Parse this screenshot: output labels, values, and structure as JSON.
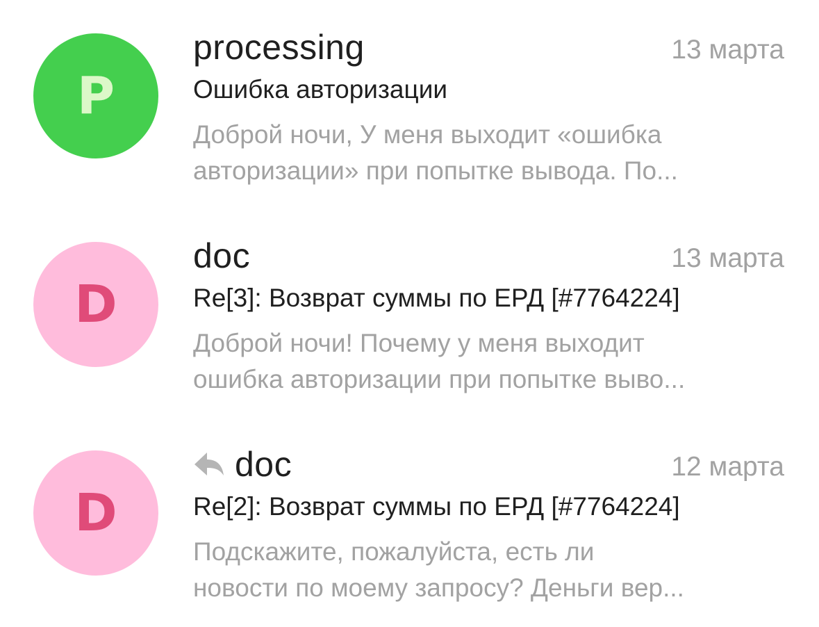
{
  "messages": [
    {
      "avatar_letter": "P",
      "avatar_bg": "#44cf4e",
      "avatar_fg": "#dcf8c8",
      "replied": false,
      "sender": "processing",
      "date": "13 марта",
      "subject": "Ошибка авторизации",
      "preview_line1": "Доброй ночи, У меня выходит «ошибка",
      "preview_line2": "авторизации» при попытке вывода. По..."
    },
    {
      "avatar_letter": "D",
      "avatar_bg": "#ffbcdc",
      "avatar_fg": "#e04b79",
      "replied": false,
      "sender": "doc",
      "date": "13 марта",
      "subject": "Re[3]: Возврат суммы по ЕРД [#7764224]",
      "preview_line1": "Доброй ночи! Почему у меня выходит",
      "preview_line2": "ошибка авторизации при попытке выво..."
    },
    {
      "avatar_letter": "D",
      "avatar_bg": "#ffbcdc",
      "avatar_fg": "#e04b79",
      "replied": true,
      "reply_icon": "reply-arrow-icon",
      "sender": "doc",
      "date": "12 марта",
      "subject": "Re[2]: Возврат суммы по ЕРД [#7764224]",
      "preview_line1": "Подскажите, пожалуйста, есть ли",
      "preview_line2": "новости по моему запросу? Деньги вер..."
    }
  ],
  "colors": {
    "primary_text": "#1f1f1f",
    "secondary_text": "#a2a2a2",
    "reply_icon": "#b5b5b5"
  }
}
